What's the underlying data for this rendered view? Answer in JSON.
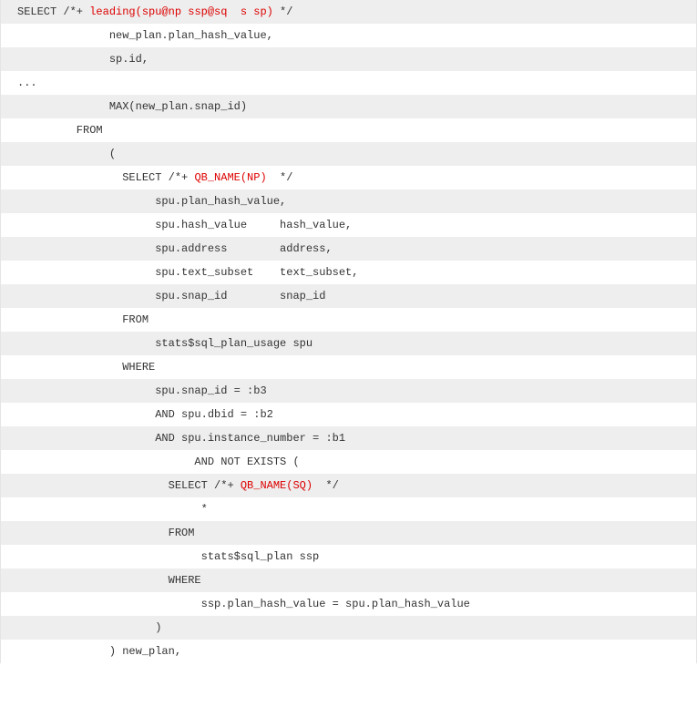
{
  "code": {
    "lines": [
      {
        "prefix": "SELECT /*+ ",
        "hint": "leading(spu@np ssp@sq  s sp)",
        "suffix": " */"
      },
      {
        "prefix": "              new_plan.plan_hash_value,"
      },
      {
        "prefix": "              sp.id,"
      },
      {
        "prefix": "..."
      },
      {
        "prefix": "              MAX(new_plan.snap_id)"
      },
      {
        "prefix": "         FROM"
      },
      {
        "prefix": "              ("
      },
      {
        "prefix": "                SELECT /*+ ",
        "hint": "QB_NAME(NP)",
        "suffix": "  */"
      },
      {
        "prefix": "                     spu.plan_hash_value,"
      },
      {
        "prefix": "                     spu.hash_value     hash_value,"
      },
      {
        "prefix": "                     spu.address        address,"
      },
      {
        "prefix": "                     spu.text_subset    text_subset,"
      },
      {
        "prefix": "                     spu.snap_id        snap_id"
      },
      {
        "prefix": "                FROM"
      },
      {
        "prefix": "                     stats$sql_plan_usage spu"
      },
      {
        "prefix": "                WHERE"
      },
      {
        "prefix": "                     spu.snap_id = :b3"
      },
      {
        "prefix": "                     AND spu.dbid = :b2"
      },
      {
        "prefix": "                     AND spu.instance_number = :b1"
      },
      {
        "prefix": "                           AND NOT EXISTS ("
      },
      {
        "prefix": "                       SELECT /*+ ",
        "hint": "QB_NAME(SQ)",
        "suffix": "  */"
      },
      {
        "prefix": "                            *"
      },
      {
        "prefix": "                       FROM"
      },
      {
        "prefix": "                            stats$sql_plan ssp"
      },
      {
        "prefix": "                       WHERE"
      },
      {
        "prefix": "                            ssp.plan_hash_value = spu.plan_hash_value"
      },
      {
        "prefix": "                     )"
      },
      {
        "prefix": "              ) new_plan,"
      }
    ]
  }
}
